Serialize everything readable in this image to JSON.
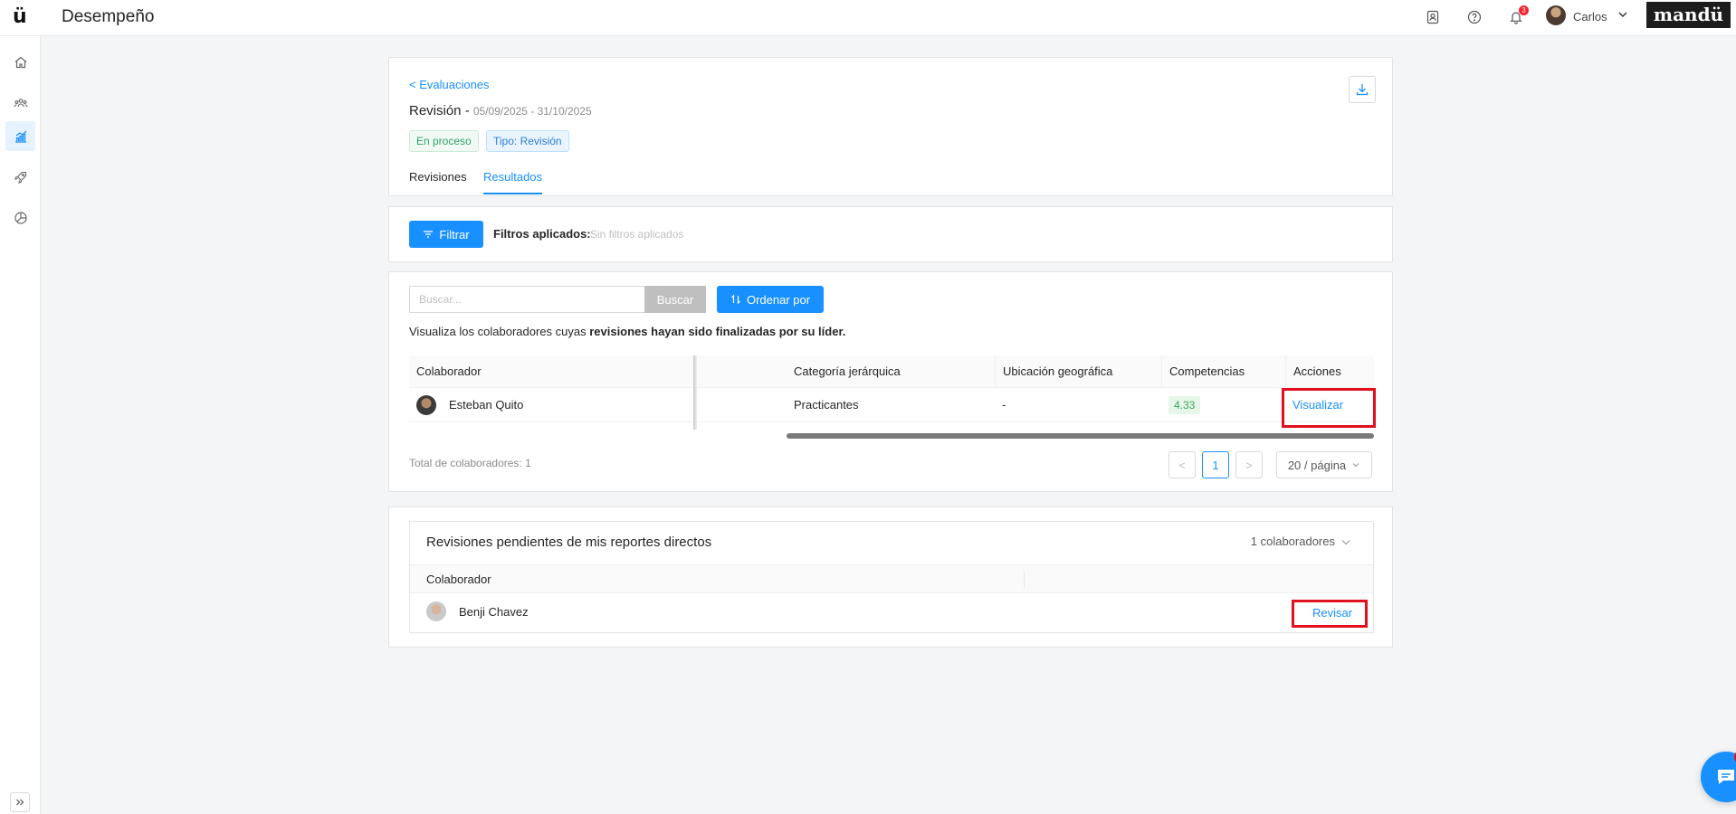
{
  "app": {
    "logo": "ü",
    "title": "Desempeño",
    "brand": "mandü"
  },
  "topbar": {
    "icons": [
      "contacts-icon",
      "help-icon",
      "bell-icon"
    ],
    "notification_count": "3",
    "user_name": "Carlos"
  },
  "sidebar": {
    "items": [
      "home-icon",
      "team-icon",
      "performance-chart-icon",
      "rocket-icon",
      "pie-chart-icon"
    ],
    "active": "performance-chart-icon"
  },
  "header": {
    "back_link": "< Evaluaciones",
    "title": "Revisión -",
    "dates": "05/09/2025 - 31/10/2025",
    "tags": {
      "status": "En proceso",
      "type": "Tipo: Revisión"
    },
    "tabs": [
      {
        "label": "Revisiones"
      },
      {
        "label": "Resultados"
      }
    ],
    "active_tab": "Resultados"
  },
  "filters": {
    "button": "Filtrar",
    "applied_label": "Filtros aplicados:",
    "applied_value": "Sin filtros aplicados"
  },
  "results": {
    "search_placeholder": "Buscar...",
    "search_button": "Buscar",
    "sort_button": "Ordenar por",
    "description_prefix": "Visualiza los colaboradores cuyas ",
    "description_bold": "revisiones hayan sido finalizadas por su líder.",
    "columns": {
      "collaborator": "Colaborador",
      "category": "Categoría jerárquica",
      "location": "Ubicación geográfica",
      "competencies": "Competencias",
      "actions": "Acciones"
    },
    "rows": [
      {
        "name": "Esteban Quito",
        "category": "Practicantes",
        "location": "-",
        "competencies": "4.33",
        "action": "Visualizar"
      }
    ],
    "total": "Total de colaboradores: 1",
    "pagination": {
      "prev": "<",
      "current": "1",
      "next": ">",
      "page_size": "20 / página"
    }
  },
  "pending": {
    "title": "Revisiones pendientes de mis reportes directos",
    "count": "1 colaboradores",
    "column": "Colaborador",
    "rows": [
      {
        "name": "Benji Chavez",
        "action": "Revisar"
      }
    ]
  },
  "chat": {
    "badge": "1"
  },
  "colors": {
    "primary": "#1890ff",
    "highlight": "#e0101e",
    "success": "#39a85a"
  }
}
